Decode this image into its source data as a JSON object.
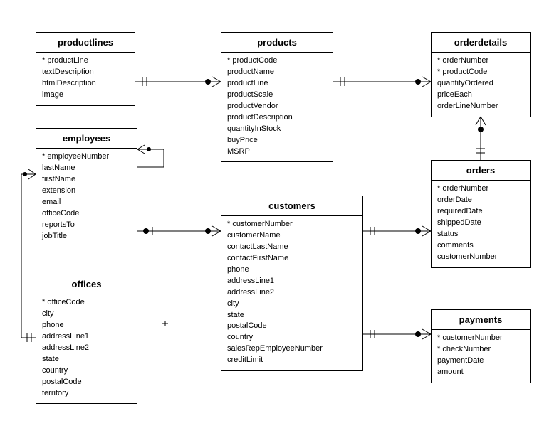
{
  "entities": {
    "productlines": {
      "title": "productlines",
      "attrs": [
        {
          "name": "productLine",
          "pk": true
        },
        {
          "name": "textDescription"
        },
        {
          "name": "htmlDescription"
        },
        {
          "name": "image"
        }
      ]
    },
    "products": {
      "title": "products",
      "attrs": [
        {
          "name": "productCode",
          "pk": true
        },
        {
          "name": "productName"
        },
        {
          "name": "productLine"
        },
        {
          "name": "productScale"
        },
        {
          "name": "productVendor"
        },
        {
          "name": "productDescription"
        },
        {
          "name": "quantityInStock"
        },
        {
          "name": "buyPrice"
        },
        {
          "name": "MSRP"
        }
      ]
    },
    "orderdetails": {
      "title": "orderdetails",
      "attrs": [
        {
          "name": "orderNumber",
          "pk": true
        },
        {
          "name": "productCode",
          "pk": true
        },
        {
          "name": "quantityOrdered"
        },
        {
          "name": "priceEach"
        },
        {
          "name": "orderLineNumber"
        }
      ]
    },
    "employees": {
      "title": "employees",
      "attrs": [
        {
          "name": "employeeNumber",
          "pk": true
        },
        {
          "name": "lastName"
        },
        {
          "name": "firstName"
        },
        {
          "name": "extension"
        },
        {
          "name": "email"
        },
        {
          "name": "officeCode"
        },
        {
          "name": "reportsTo"
        },
        {
          "name": "jobTitle"
        }
      ]
    },
    "customers": {
      "title": "customers",
      "attrs": [
        {
          "name": "customerNumber",
          "pk": true
        },
        {
          "name": "customerName"
        },
        {
          "name": "contactLastName"
        },
        {
          "name": "contactFirstName"
        },
        {
          "name": "phone"
        },
        {
          "name": "addressLine1"
        },
        {
          "name": "addressLine2"
        },
        {
          "name": "city"
        },
        {
          "name": "state"
        },
        {
          "name": "postalCode"
        },
        {
          "name": "country"
        },
        {
          "name": "salesRepEmployeeNumber"
        },
        {
          "name": "creditLimit"
        }
      ]
    },
    "orders": {
      "title": "orders",
      "attrs": [
        {
          "name": "orderNumber",
          "pk": true
        },
        {
          "name": "orderDate"
        },
        {
          "name": "requiredDate"
        },
        {
          "name": "shippedDate"
        },
        {
          "name": "status"
        },
        {
          "name": "comments"
        },
        {
          "name": "customerNumber"
        }
      ]
    },
    "offices": {
      "title": "offices",
      "attrs": [
        {
          "name": "officeCode",
          "pk": true
        },
        {
          "name": "city"
        },
        {
          "name": "phone"
        },
        {
          "name": "addressLine1"
        },
        {
          "name": "addressLine2"
        },
        {
          "name": "state"
        },
        {
          "name": "country"
        },
        {
          "name": "postalCode"
        },
        {
          "name": "territory"
        }
      ]
    },
    "payments": {
      "title": "payments",
      "attrs": [
        {
          "name": "customerNumber",
          "pk": true
        },
        {
          "name": "checkNumber",
          "pk": true
        },
        {
          "name": "paymentDate"
        },
        {
          "name": "amount"
        }
      ]
    }
  },
  "chart_data": {
    "type": "er-diagram",
    "entities": [
      {
        "name": "productlines",
        "primaryKey": [
          "productLine"
        ],
        "columns": [
          "productLine",
          "textDescription",
          "htmlDescription",
          "image"
        ]
      },
      {
        "name": "products",
        "primaryKey": [
          "productCode"
        ],
        "columns": [
          "productCode",
          "productName",
          "productLine",
          "productScale",
          "productVendor",
          "productDescription",
          "quantityInStock",
          "buyPrice",
          "MSRP"
        ]
      },
      {
        "name": "orderdetails",
        "primaryKey": [
          "orderNumber",
          "productCode"
        ],
        "columns": [
          "orderNumber",
          "productCode",
          "quantityOrdered",
          "priceEach",
          "orderLineNumber"
        ]
      },
      {
        "name": "employees",
        "primaryKey": [
          "employeeNumber"
        ],
        "columns": [
          "employeeNumber",
          "lastName",
          "firstName",
          "extension",
          "email",
          "officeCode",
          "reportsTo",
          "jobTitle"
        ]
      },
      {
        "name": "customers",
        "primaryKey": [
          "customerNumber"
        ],
        "columns": [
          "customerNumber",
          "customerName",
          "contactLastName",
          "contactFirstName",
          "phone",
          "addressLine1",
          "addressLine2",
          "city",
          "state",
          "postalCode",
          "country",
          "salesRepEmployeeNumber",
          "creditLimit"
        ]
      },
      {
        "name": "orders",
        "primaryKey": [
          "orderNumber"
        ],
        "columns": [
          "orderNumber",
          "orderDate",
          "requiredDate",
          "shippedDate",
          "status",
          "comments",
          "customerNumber"
        ]
      },
      {
        "name": "offices",
        "primaryKey": [
          "officeCode"
        ],
        "columns": [
          "officeCode",
          "city",
          "phone",
          "addressLine1",
          "addressLine2",
          "state",
          "country",
          "postalCode",
          "territory"
        ]
      },
      {
        "name": "payments",
        "primaryKey": [
          "customerNumber",
          "checkNumber"
        ],
        "columns": [
          "customerNumber",
          "checkNumber",
          "paymentDate",
          "amount"
        ]
      }
    ],
    "relationships": [
      {
        "from": "productlines",
        "fromCard": "one",
        "to": "products",
        "toCard": "many"
      },
      {
        "from": "products",
        "fromCard": "one",
        "to": "orderdetails",
        "toCard": "many"
      },
      {
        "from": "orders",
        "fromCard": "one",
        "to": "orderdetails",
        "toCard": "many"
      },
      {
        "from": "customers",
        "fromCard": "one",
        "to": "orders",
        "toCard": "many"
      },
      {
        "from": "customers",
        "fromCard": "one",
        "to": "payments",
        "toCard": "many"
      },
      {
        "from": "employees",
        "fromCard": "one",
        "to": "customers",
        "toCard": "many"
      },
      {
        "from": "employees",
        "fromCard": "one",
        "to": "employees",
        "toCard": "many",
        "note": "reportsTo self-reference"
      },
      {
        "from": "offices",
        "fromCard": "one",
        "to": "employees",
        "toCard": "many"
      }
    ]
  }
}
